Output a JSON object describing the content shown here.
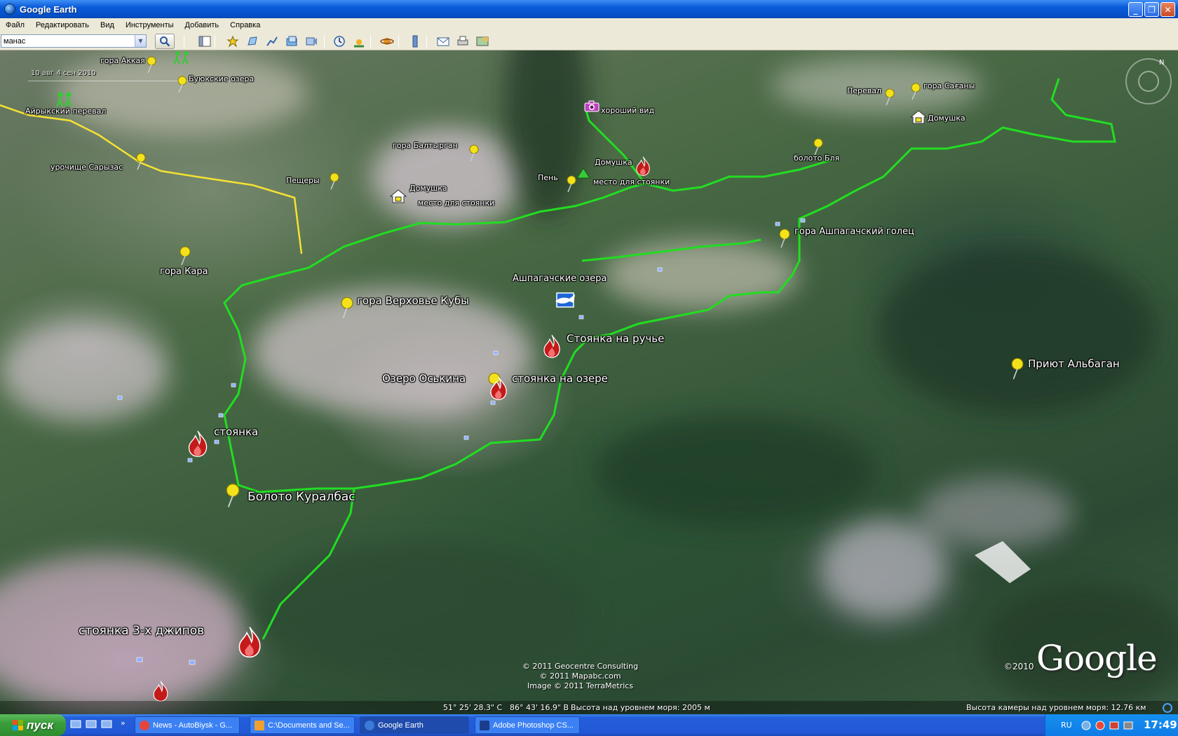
{
  "window": {
    "title": "Google Earth",
    "minimize": "_",
    "maximize": "❐",
    "close": "✕"
  },
  "menu": [
    "Файл",
    "Редактировать",
    "Вид",
    "Инструменты",
    "Добавить",
    "Справка"
  ],
  "search": {
    "value": "манас"
  },
  "timeline": {
    "label": "10 авг 4 сен 2010"
  },
  "labels": {
    "gora_akkaya": "гора Аккая",
    "buyukskie_ozera": "Буюкские озера",
    "ayrykskiy_pereval": "Айрыкский перевал",
    "urochishche_saryzas": "урочище Сарызас",
    "peshchery": "Пещеры",
    "gora_baltyrgan": "гора Балтырган",
    "horoshiy_vid": "хороший вид",
    "domushka_1": "Домушка",
    "mesto_stoyanki_1": "место для стоянки",
    "pen": "Пень",
    "domushka_2": "Домушка",
    "mesto_stoyanki_2": "место для стоянки",
    "pereval": "Перевал",
    "gora_sagany": "гора Сағаны",
    "domushka_3": "Домушка",
    "boloto_blya": "болото Бля",
    "gora_ashpagachskiy": "гора Ашпагачский голец",
    "gora_kara": "гора Кара",
    "ashpagachskie_ozera": "Ашпагачские озера",
    "gora_verhovye_kuby": "гора Верховье Кубы",
    "stoyanka_na_ruchye": "Стоянка на ручье",
    "ozero_oskina": "Озеро Оськина",
    "stoyanka_na_ozere": "стоянка на озере",
    "priyut_albagan": "Приют Альбаган",
    "stoyanka": "стоянка",
    "boloto_kuralbas": "Болото Куралбас",
    "stoyanka_3_dzhipov": "стоянка 3-х джипов"
  },
  "copyright": {
    "line1": "© 2011 Geocentre Consulting",
    "line2": "© 2011 Mapabc.com",
    "line3": "Image © 2011 TerraMetrics"
  },
  "logo": {
    "year": "©2010",
    "text": "Google"
  },
  "status": {
    "lat": "51° 25' 28.3\" С",
    "lon": "86° 43' 16.9\" В",
    "elevation": "Высота над уровнем моря:  2005 м",
    "camera": "Высота камеры над уровнем моря:     12.76 км"
  },
  "taskbar": {
    "start": "пуск",
    "tasks": [
      {
        "label": "News - AutoBiysk - G...",
        "color": "#e8443a"
      },
      {
        "label": "C:\\Documents and Se...",
        "color": "#f0a030"
      },
      {
        "label": "Google Earth",
        "color": "#3a7ad8"
      },
      {
        "label": "Adobe Photoshop CS...",
        "color": "#1c3c8c"
      }
    ],
    "lang": "RU",
    "clock": "17:49"
  },
  "colors": {
    "track_green": "#22dd22",
    "track_yellow": "#f5e232",
    "pin_yellow": "#f3e21a",
    "fire_red": "#c41a1a"
  }
}
